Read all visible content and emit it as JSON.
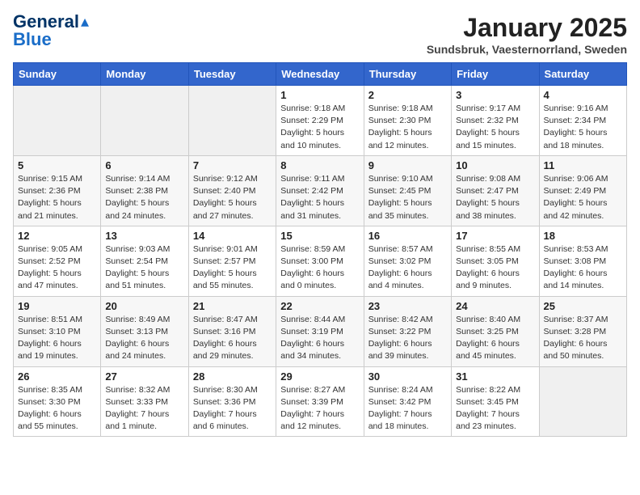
{
  "header": {
    "logo_line1": "General",
    "logo_line2": "Blue",
    "month_year": "January 2025",
    "location": "Sundsbruk, Vaesternorrland, Sweden"
  },
  "weekdays": [
    "Sunday",
    "Monday",
    "Tuesday",
    "Wednesday",
    "Thursday",
    "Friday",
    "Saturday"
  ],
  "weeks": [
    [
      {
        "day": "",
        "info": ""
      },
      {
        "day": "",
        "info": ""
      },
      {
        "day": "",
        "info": ""
      },
      {
        "day": "1",
        "info": "Sunrise: 9:18 AM\nSunset: 2:29 PM\nDaylight: 5 hours\nand 10 minutes."
      },
      {
        "day": "2",
        "info": "Sunrise: 9:18 AM\nSunset: 2:30 PM\nDaylight: 5 hours\nand 12 minutes."
      },
      {
        "day": "3",
        "info": "Sunrise: 9:17 AM\nSunset: 2:32 PM\nDaylight: 5 hours\nand 15 minutes."
      },
      {
        "day": "4",
        "info": "Sunrise: 9:16 AM\nSunset: 2:34 PM\nDaylight: 5 hours\nand 18 minutes."
      }
    ],
    [
      {
        "day": "5",
        "info": "Sunrise: 9:15 AM\nSunset: 2:36 PM\nDaylight: 5 hours\nand 21 minutes."
      },
      {
        "day": "6",
        "info": "Sunrise: 9:14 AM\nSunset: 2:38 PM\nDaylight: 5 hours\nand 24 minutes."
      },
      {
        "day": "7",
        "info": "Sunrise: 9:12 AM\nSunset: 2:40 PM\nDaylight: 5 hours\nand 27 minutes."
      },
      {
        "day": "8",
        "info": "Sunrise: 9:11 AM\nSunset: 2:42 PM\nDaylight: 5 hours\nand 31 minutes."
      },
      {
        "day": "9",
        "info": "Sunrise: 9:10 AM\nSunset: 2:45 PM\nDaylight: 5 hours\nand 35 minutes."
      },
      {
        "day": "10",
        "info": "Sunrise: 9:08 AM\nSunset: 2:47 PM\nDaylight: 5 hours\nand 38 minutes."
      },
      {
        "day": "11",
        "info": "Sunrise: 9:06 AM\nSunset: 2:49 PM\nDaylight: 5 hours\nand 42 minutes."
      }
    ],
    [
      {
        "day": "12",
        "info": "Sunrise: 9:05 AM\nSunset: 2:52 PM\nDaylight: 5 hours\nand 47 minutes."
      },
      {
        "day": "13",
        "info": "Sunrise: 9:03 AM\nSunset: 2:54 PM\nDaylight: 5 hours\nand 51 minutes."
      },
      {
        "day": "14",
        "info": "Sunrise: 9:01 AM\nSunset: 2:57 PM\nDaylight: 5 hours\nand 55 minutes."
      },
      {
        "day": "15",
        "info": "Sunrise: 8:59 AM\nSunset: 3:00 PM\nDaylight: 6 hours\nand 0 minutes."
      },
      {
        "day": "16",
        "info": "Sunrise: 8:57 AM\nSunset: 3:02 PM\nDaylight: 6 hours\nand 4 minutes."
      },
      {
        "day": "17",
        "info": "Sunrise: 8:55 AM\nSunset: 3:05 PM\nDaylight: 6 hours\nand 9 minutes."
      },
      {
        "day": "18",
        "info": "Sunrise: 8:53 AM\nSunset: 3:08 PM\nDaylight: 6 hours\nand 14 minutes."
      }
    ],
    [
      {
        "day": "19",
        "info": "Sunrise: 8:51 AM\nSunset: 3:10 PM\nDaylight: 6 hours\nand 19 minutes."
      },
      {
        "day": "20",
        "info": "Sunrise: 8:49 AM\nSunset: 3:13 PM\nDaylight: 6 hours\nand 24 minutes."
      },
      {
        "day": "21",
        "info": "Sunrise: 8:47 AM\nSunset: 3:16 PM\nDaylight: 6 hours\nand 29 minutes."
      },
      {
        "day": "22",
        "info": "Sunrise: 8:44 AM\nSunset: 3:19 PM\nDaylight: 6 hours\nand 34 minutes."
      },
      {
        "day": "23",
        "info": "Sunrise: 8:42 AM\nSunset: 3:22 PM\nDaylight: 6 hours\nand 39 minutes."
      },
      {
        "day": "24",
        "info": "Sunrise: 8:40 AM\nSunset: 3:25 PM\nDaylight: 6 hours\nand 45 minutes."
      },
      {
        "day": "25",
        "info": "Sunrise: 8:37 AM\nSunset: 3:28 PM\nDaylight: 6 hours\nand 50 minutes."
      }
    ],
    [
      {
        "day": "26",
        "info": "Sunrise: 8:35 AM\nSunset: 3:30 PM\nDaylight: 6 hours\nand 55 minutes."
      },
      {
        "day": "27",
        "info": "Sunrise: 8:32 AM\nSunset: 3:33 PM\nDaylight: 7 hours\nand 1 minute."
      },
      {
        "day": "28",
        "info": "Sunrise: 8:30 AM\nSunset: 3:36 PM\nDaylight: 7 hours\nand 6 minutes."
      },
      {
        "day": "29",
        "info": "Sunrise: 8:27 AM\nSunset: 3:39 PM\nDaylight: 7 hours\nand 12 minutes."
      },
      {
        "day": "30",
        "info": "Sunrise: 8:24 AM\nSunset: 3:42 PM\nDaylight: 7 hours\nand 18 minutes."
      },
      {
        "day": "31",
        "info": "Sunrise: 8:22 AM\nSunset: 3:45 PM\nDaylight: 7 hours\nand 23 minutes."
      },
      {
        "day": "",
        "info": ""
      }
    ]
  ]
}
